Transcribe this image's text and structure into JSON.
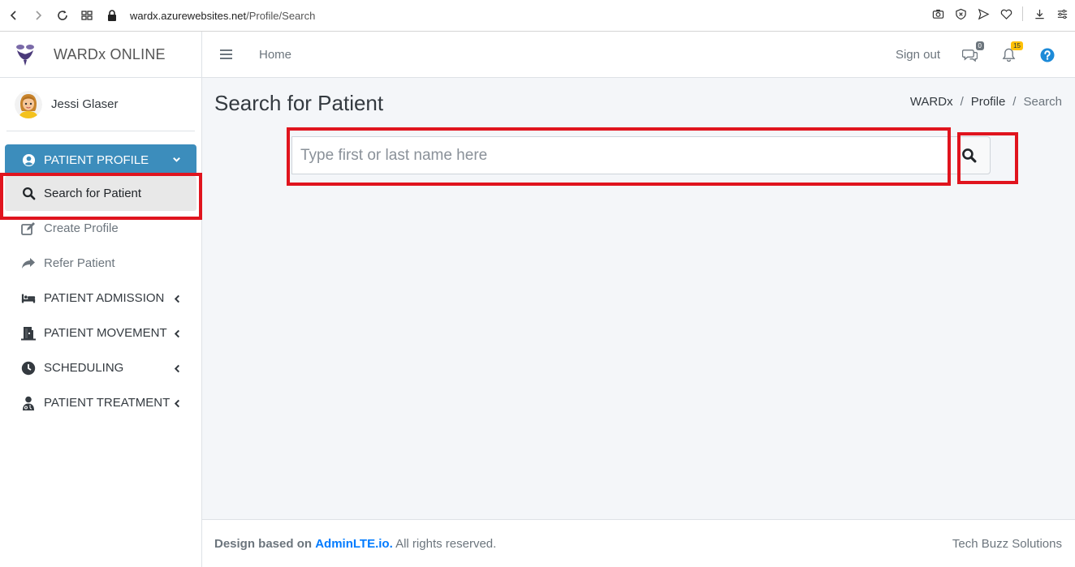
{
  "browser": {
    "url_host": "wardx.azurewebsites.net",
    "url_path": "/Profile/Search"
  },
  "brand": {
    "name": "WARDx ONLINE"
  },
  "user": {
    "name": "Jessi Glaser"
  },
  "sidebar": {
    "header": {
      "label": "PATIENT PROFILE",
      "icon": "user-circle-icon"
    },
    "items": [
      {
        "label": "Search for Patient",
        "icon": "search-icon",
        "active": true
      },
      {
        "label": "Create Profile",
        "icon": "edit-icon"
      },
      {
        "label": "Refer Patient",
        "icon": "share-icon"
      },
      {
        "label": "PATIENT ADMISSION",
        "icon": "bed-icon"
      },
      {
        "label": "PATIENT MOVEMENT",
        "icon": "door-icon"
      },
      {
        "label": "SCHEDULING",
        "icon": "clock-icon"
      },
      {
        "label": "PATIENT TREATMENT",
        "icon": "doctor-icon"
      }
    ]
  },
  "topbar": {
    "home_label": "Home",
    "signout_label": "Sign out",
    "messages_count": "0",
    "notifications_count": "15"
  },
  "content": {
    "title": "Search for Patient",
    "breadcrumb": [
      "WARDx",
      "Profile",
      "Search"
    ],
    "search_placeholder": "Type first or last name here"
  },
  "footer": {
    "prefix": "Design based on",
    "link": "AdminLTE.io.",
    "suffix": "All rights reserved.",
    "company": "Tech Buzz Solutions"
  },
  "colors": {
    "accent": "#3c8dbc",
    "highlight": "#e0141e",
    "content_bg": "#f4f6f9",
    "help_blue": "#1c8ad8",
    "badge_yellow": "#ffc107"
  }
}
